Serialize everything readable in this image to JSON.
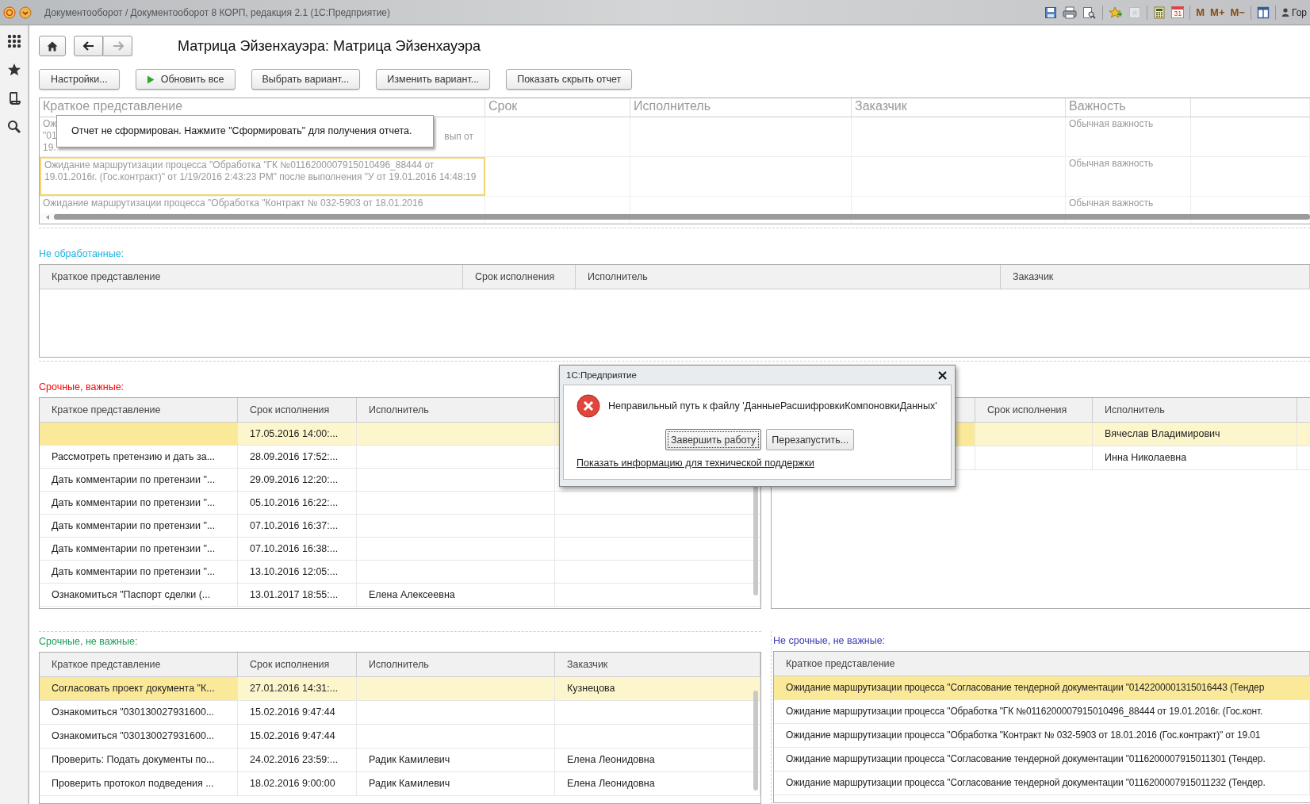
{
  "window": {
    "title": "Документооборот / Документооборот 8 КОРП, редакция 2.1  (1С:Предприятие)",
    "calendar_day": "31",
    "memory_buttons": [
      "M",
      "M+",
      "M−"
    ],
    "user": "Гор"
  },
  "page": {
    "title": "Матрица Эйзенхауэра: Матрица Эйзенхауэра"
  },
  "commands": [
    "Настройки...",
    "Обновить все",
    "Выбрать вариант...",
    "Изменить вариант...",
    "Показать скрыть отчет"
  ],
  "report": {
    "columns": [
      "Краткое представление",
      "Срок",
      "Исполнитель",
      "Заказчик",
      "Важность"
    ],
    "rows": [
      {
        "brief_lines": [
          "Ож",
          "\"01",
          "19."
        ],
        "brief_tail": "вып от",
        "importance": "Обычная важность",
        "selected": false
      },
      {
        "brief": "Ожидание маршрутизации процесса \"Обработка \"ГК №0116200007915010496_88444 от 19.01.2016г. (Гос.контракт)\" от 1/19/2016 2:43:23 PM\" после выполнения \"У от 19.01.2016 14:48:19",
        "importance": "Обычная важность",
        "selected": true
      },
      {
        "brief": "Ожидание маршрутизации процесса \"Обработка \"Контракт  № 032-5903 от 18.01.2016",
        "importance": "Обычная важность",
        "selected": false
      }
    ],
    "tooltip": "Отчет не сформирован. Нажмите \"Сформировать\" для получения отчета."
  },
  "sections": [
    {
      "label": "Не обработанные:",
      "color": "#1eb4e6",
      "tables": [
        {
          "columns": [
            "Краткое представление",
            "Срок исполнения",
            "Исполнитель",
            "Заказчик"
          ]
        }
      ]
    },
    {
      "label": "Срочные, важные:",
      "color": "#ff0000",
      "tables": [
        {
          "columns": [
            "Краткое представление",
            "Срок исполнения",
            "Исполнитель"
          ],
          "rows": [
            {
              "due": "17.05.2016 14:00:...",
              "selected": true
            },
            {
              "brief": "Рассмотреть претензию и дать за...",
              "due": "28.09.2016 17:52:...",
              "selected": false
            },
            {
              "brief": "Дать комментарии по претензии \"...",
              "due": "29.09.2016 12:20:...",
              "selected": false
            },
            {
              "brief": "Дать комментарии по претензии \"...",
              "due": "05.10.2016 16:22:...",
              "selected": false
            },
            {
              "brief": "Дать комментарии по претензии \"...",
              "due": "07.10.2016 16:37:...",
              "selected": false
            },
            {
              "brief": "Дать комментарии по претензии \"...",
              "due": "07.10.2016 16:38:...",
              "selected": false
            },
            {
              "brief": "Дать комментарии по претензии \"...",
              "due": "13.10.2016 12:05:...",
              "selected": false
            },
            {
              "brief": "Ознакомиться \"Паспорт сделки (...",
              "due": "13.01.2017 18:55:...",
              "executor": "Елена Алексеевна",
              "selected": false
            }
          ]
        },
        {
          "columns": [
            "Срок исполнения",
            "Исполнитель"
          ],
          "rows": [
            {
              "executor": "Вячеслав Владимирович",
              "selected": true
            },
            {
              "executor": "Инна Николаевна",
              "selected": false
            }
          ]
        }
      ]
    },
    {
      "label": "Срочные, не важные:",
      "color": "#1a9e5c",
      "tables": [
        {
          "columns": [
            "Краткое представление",
            "Срок исполнения",
            "Исполнитель",
            "Заказчик"
          ],
          "rows": [
            {
              "brief": "Согласовать проект документа \"К...",
              "due": "27.01.2016 14:31:...",
              "customer": "Кузнецова",
              "selected": true
            },
            {
              "brief": "Ознакомиться \"030130027931600...",
              "due": "15.02.2016 9:47:44",
              "selected": false
            },
            {
              "brief": "Ознакомиться \"030130027931600...",
              "due": "15.02.2016 9:47:44",
              "selected": false
            },
            {
              "brief": "Проверить: Подать документы по...",
              "due": "24.02.2016 23:59:...",
              "executor": "Радик Камилевич",
              "customer": "Елена Леонидовна",
              "selected": false
            },
            {
              "brief": "Проверить протокол подведения ...",
              "due": "18.02.2016 9:00:00",
              "executor": "Радик Камилевич",
              "customer": "Елена Леонидовна",
              "selected": false
            }
          ]
        }
      ]
    },
    {
      "label": "Не срочные, не важные:",
      "color": "#3c3cb4",
      "tables": [
        {
          "columns": [
            "Краткое представление"
          ],
          "rows": [
            {
              "brief": "Ожидание маршрутизации процесса \"Согласование тендерной документации \"0142200001315016443 (Тендер",
              "selected": true
            },
            {
              "brief": "Ожидание маршрутизации процесса \"Обработка \"ГК №0116200007915010496_88444 от 19.01.2016г. (Гос.конт.",
              "selected": false
            },
            {
              "brief": "Ожидание маршрутизации процесса \"Обработка \"Контракт  № 032-5903 от 18.01.2016 (Гос.контракт)\" от 19.01",
              "selected": false
            },
            {
              "brief": "Ожидание маршрутизации процесса \"Согласование тендерной документации \"0116200007915011301 (Тендер.",
              "selected": false
            },
            {
              "brief": "Ожидание маршрутизации процесса \"Согласование тендерной документации \"0116200007915011232 (Тендер.",
              "selected": false
            }
          ]
        }
      ]
    }
  ],
  "dialog": {
    "title": "1С:Предприятие",
    "message": "Неправильный путь к файлу 'ДанныеРасшифровкиКомпоновкиДанных'",
    "buttons": [
      {
        "label": "Завершить работу",
        "selected": true
      },
      {
        "label": "Перезапустить...",
        "selected": false
      }
    ],
    "link": "Показать информацию для технической поддержки"
  }
}
